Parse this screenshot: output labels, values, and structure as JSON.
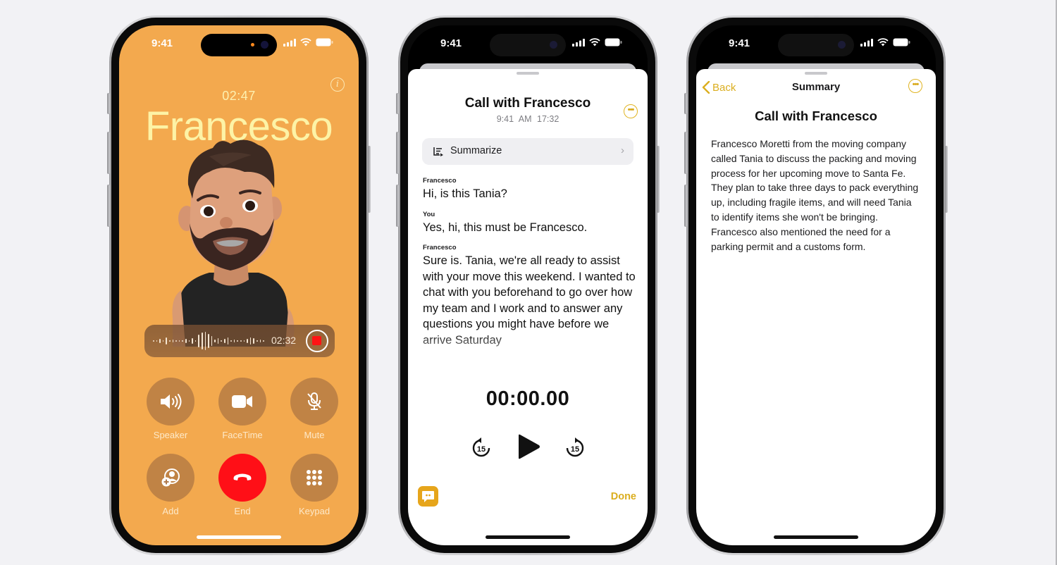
{
  "status_bar": {
    "time": "9:41"
  },
  "call_screen": {
    "elapsed": "02:47",
    "caller_name": "Francesco",
    "recording": {
      "elapsed": "02:32"
    },
    "controls": [
      {
        "label": "Speaker",
        "icon": "speaker-icon"
      },
      {
        "label": "FaceTime",
        "icon": "video-camera-icon"
      },
      {
        "label": "Mute",
        "icon": "mic-slash-icon"
      },
      {
        "label": "Add",
        "icon": "add-person-icon"
      },
      {
        "label": "End",
        "icon": "end-call-icon"
      },
      {
        "label": "Keypad",
        "icon": "keypad-icon"
      }
    ],
    "colors": {
      "background": "#f3a94e",
      "name": "#fdf3a6",
      "end": "#ff0f17"
    }
  },
  "recording_sheet": {
    "title": "Call with Francesco",
    "subtitle": "9:41 AM  17:32",
    "summarize_label": "Summarize",
    "transcript": [
      {
        "speaker": "Francesco",
        "text": "Hi, is this Tania?"
      },
      {
        "speaker": "You",
        "text": "Yes, hi, this must be Francesco."
      },
      {
        "speaker": "Francesco",
        "text": "Sure is. Tania, we're all ready to assist with your move this weekend. I wanted to chat with you beforehand to go over how my team and I work and to answer any questions you might have before we arrive Saturday"
      }
    ],
    "playback_time": "00:00.00",
    "skip_back_seconds": "15",
    "skip_forward_seconds": "15",
    "done_label": "Done",
    "colors": {
      "accent": "#dbae1f"
    }
  },
  "summary_sheet": {
    "back_label": "Back",
    "nav_title": "Summary",
    "heading": "Call with Francesco",
    "body": "Francesco Moretti from the moving company called Tania to discuss the packing and moving process for her upcoming move to Santa Fe. They plan to take three days to pack everything up, including fragile items, and will need Tania to identify items she won't be bringing. Francesco also mentioned the need for a parking permit and a customs form."
  }
}
